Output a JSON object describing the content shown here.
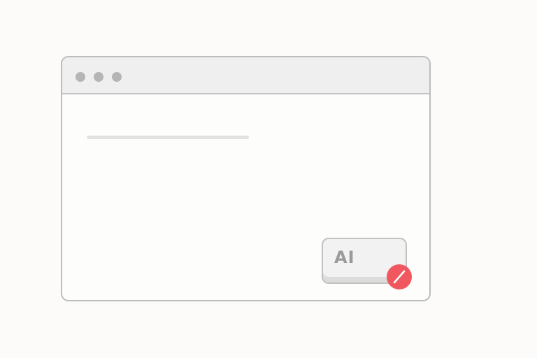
{
  "window": {
    "title_dots": [
      "close",
      "minimize",
      "maximize"
    ]
  },
  "ai_key": {
    "label": "AI"
  },
  "badge": {
    "icon": "prohibited-icon",
    "color": "#f0575f"
  },
  "colors": {
    "background": "#fcfbf9",
    "window_border": "#bcbcbc",
    "titlebar": "#efefef",
    "dots": "#b5b5b5",
    "key_text": "#9a9a9a"
  }
}
